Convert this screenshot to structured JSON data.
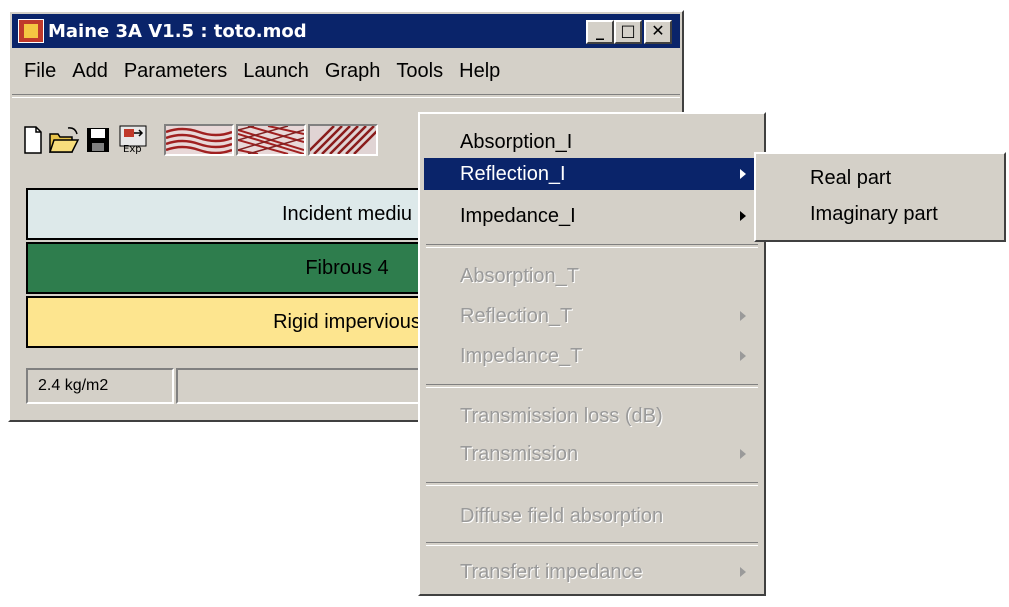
{
  "window": {
    "title": "Maine 3A V1.5 : toto.mod",
    "controls": {
      "minimize": "_",
      "maximize": "□",
      "close": "✕"
    }
  },
  "menubar": {
    "items": [
      "File",
      "Add",
      "Parameters",
      "Launch",
      "Graph",
      "Tools",
      "Help"
    ]
  },
  "toolbar": {
    "icons": [
      "new-icon",
      "open-icon",
      "save-icon",
      "export-icon",
      "layer-pattern-1-icon",
      "layer-pattern-2-icon",
      "layer-pattern-3-icon"
    ],
    "export_label": "Exp"
  },
  "layers": [
    {
      "label": "Incident mediu",
      "color": "#dde9ea"
    },
    {
      "label": "Fibrous 4",
      "color": "#2e7d4d"
    },
    {
      "label": "Rigid impervious",
      "color": "#fde58f"
    }
  ],
  "status": {
    "value": "2.4",
    "unit": "kg/m2"
  },
  "graph_menu": {
    "items": [
      {
        "label": "Absorption_I",
        "enabled": true,
        "submenu": false
      },
      {
        "label": "Reflection_I",
        "enabled": true,
        "submenu": true,
        "selected": true
      },
      {
        "label": "Impedance_I",
        "enabled": true,
        "submenu": true
      },
      {
        "label": "Absorption_T",
        "enabled": false,
        "submenu": false
      },
      {
        "label": "Reflection_T",
        "enabled": false,
        "submenu": true
      },
      {
        "label": "Impedance_T",
        "enabled": false,
        "submenu": true
      },
      {
        "label": "Transmission loss (dB)",
        "enabled": false,
        "submenu": false
      },
      {
        "label": "Transmission",
        "enabled": false,
        "submenu": true
      },
      {
        "label": "Diffuse field absorption",
        "enabled": false,
        "submenu": false
      },
      {
        "label": "Transfert impedance",
        "enabled": false,
        "submenu": true
      }
    ]
  },
  "reflection_submenu": {
    "items": [
      {
        "label": "Real part"
      },
      {
        "label": "Imaginary part"
      }
    ]
  },
  "colors": {
    "titlebar": "#0a246a",
    "menu_selected": "#0a246a",
    "face": "#d4d0c8",
    "disabled_text": "#9a9a9a"
  }
}
